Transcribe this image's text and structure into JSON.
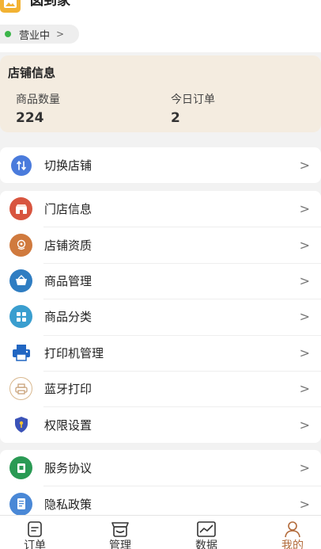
{
  "header": {
    "shop_name": "囡到家",
    "status": "营业中",
    "status_color": "#3bb54a"
  },
  "info_card": {
    "title": "店铺信息",
    "stats": [
      {
        "label": "商品数量",
        "value": "224"
      },
      {
        "label": "今日订单",
        "value": "2"
      }
    ],
    "background": "#f4ece0"
  },
  "sections": [
    {
      "items": [
        {
          "label": "切换店铺",
          "icon": "switch-icon",
          "color": "#4a7bdc"
        }
      ]
    },
    {
      "items": [
        {
          "label": "门店信息",
          "icon": "storefront-icon",
          "color": "#d8553f"
        },
        {
          "label": "店铺资质",
          "icon": "certificate-icon",
          "color": "#d07a3e"
        },
        {
          "label": "商品管理",
          "icon": "basket-icon",
          "color": "#2f7dc2"
        },
        {
          "label": "商品分类",
          "icon": "grid-icon",
          "color": "#3a9ecf"
        },
        {
          "label": "打印机管理",
          "icon": "printer-icon",
          "color": "#2166c2"
        },
        {
          "label": "蓝牙打印",
          "icon": "bluetooth-print-icon",
          "color": "#c8a27a"
        },
        {
          "label": "权限设置",
          "icon": "shield-icon",
          "color": "#3b53b8"
        }
      ]
    },
    {
      "items": [
        {
          "label": "服务协议",
          "icon": "agreement-icon",
          "color": "#2a9a54"
        },
        {
          "label": "隐私政策",
          "icon": "document-icon",
          "color": "#4a88d6"
        }
      ]
    }
  ],
  "tabbar": {
    "tabs": [
      {
        "label": "订单",
        "icon": "order-icon"
      },
      {
        "label": "管理",
        "icon": "manage-icon"
      },
      {
        "label": "数据",
        "icon": "chart-icon"
      },
      {
        "label": "我的",
        "icon": "profile-icon",
        "active": true
      }
    ],
    "active_color": "#b26a3a"
  }
}
